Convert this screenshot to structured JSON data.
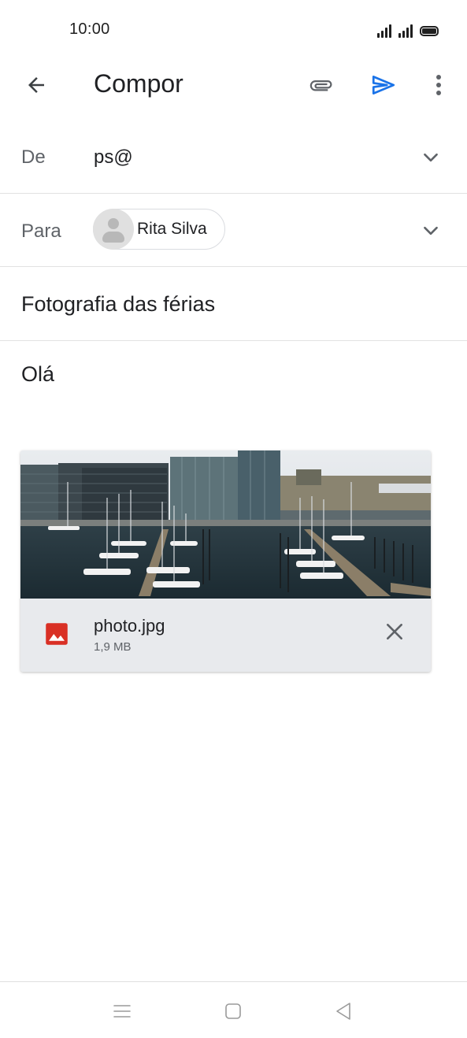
{
  "status_bar": {
    "time": "10:00"
  },
  "app_bar": {
    "title": "Compor",
    "icons": [
      "arrow-back-icon",
      "paperclip-icon",
      "send-icon",
      "more-vert-icon"
    ],
    "send_color": "#1a73e8"
  },
  "from": {
    "label": "De",
    "value": "ps@"
  },
  "to": {
    "label": "Para",
    "recipient": "Rita Silva"
  },
  "subject": {
    "value": "Fotografia das férias"
  },
  "body": {
    "text": "Olá"
  },
  "attachment": {
    "file_name": "photo.jpg",
    "file_size": "1,9 MB",
    "icon": "image-file-icon",
    "icon_color": "#d93025"
  },
  "nav_bar": {
    "icons": [
      "menu-icon",
      "home-square-icon",
      "back-triangle-icon"
    ]
  }
}
